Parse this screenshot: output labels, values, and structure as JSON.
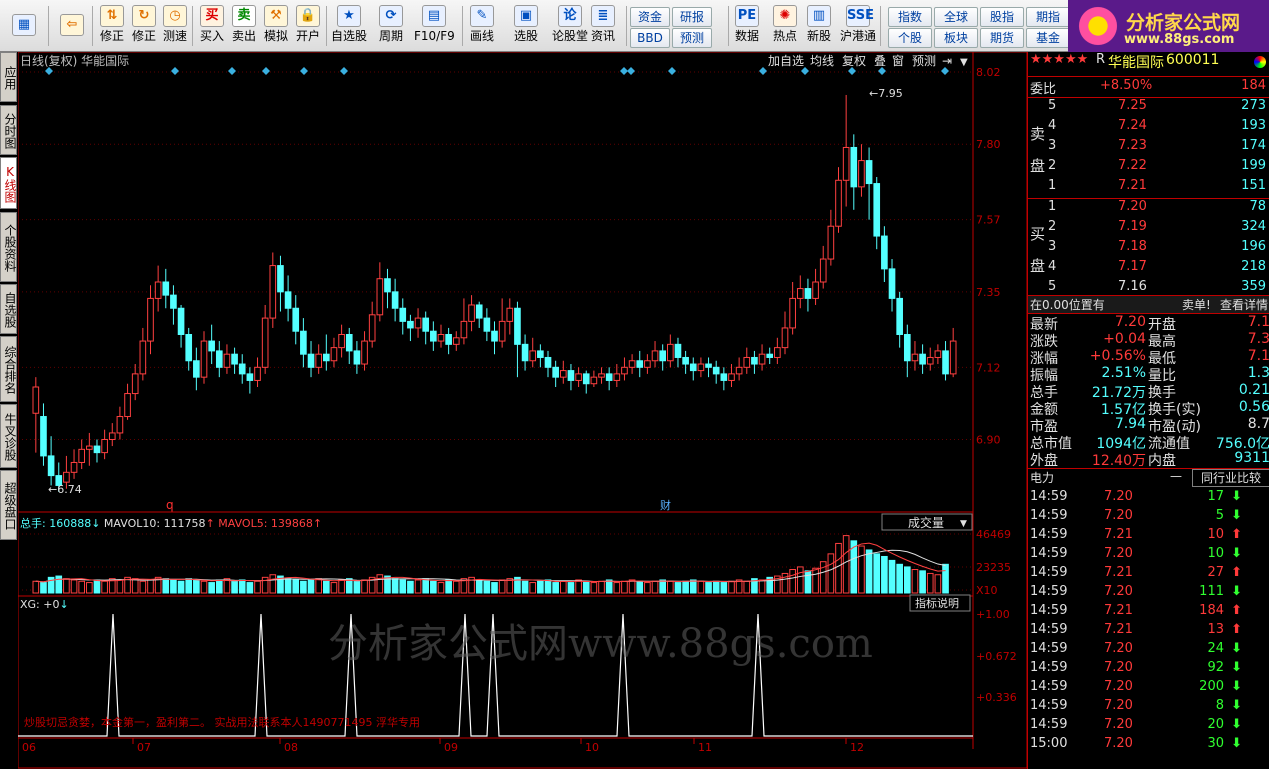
{
  "toolbar": {
    "items": [
      {
        "label": "",
        "icon": "windows-icon"
      },
      {
        "label": "",
        "icon": "back-arrow-icon"
      },
      {
        "label": "修正",
        "icon": "up-down-icon"
      },
      {
        "label": "修正",
        "icon": "refresh-icon"
      },
      {
        "label": "测速",
        "icon": "clock-icon"
      },
      {
        "label": "买入",
        "glyph": "买"
      },
      {
        "label": "卖出",
        "glyph": "卖"
      },
      {
        "label": "模拟",
        "icon": "hammer-icon"
      },
      {
        "label": "开户",
        "icon": "lock-icon"
      },
      {
        "label": "自选股",
        "icon": "star-icon"
      },
      {
        "label": "周期",
        "icon": "cycle-icon"
      },
      {
        "label": "F10/F9",
        "icon": "f10-icon"
      },
      {
        "label": "画线",
        "icon": "pen-icon"
      },
      {
        "label": "选股",
        "icon": "chart-icon"
      },
      {
        "label": "论股堂",
        "glyph": "论"
      },
      {
        "label": "资讯",
        "icon": "news-icon"
      },
      {
        "label": "数据",
        "glyph": "PE"
      },
      {
        "label": "热点",
        "icon": "fire-icon"
      },
      {
        "label": "新股",
        "icon": "ipo-icon"
      },
      {
        "label": "沪港通",
        "glyph": "SSE"
      }
    ],
    "small_buttons": [
      "资金",
      "BBD",
      "研报",
      "预测",
      "指数",
      "个股",
      "全球",
      "板块",
      "股指",
      "期货",
      "期指",
      "基金"
    ]
  },
  "logo": {
    "title": "分析家公式网",
    "url": "www.88gs.com"
  },
  "side_tabs": [
    "应用",
    "分时图",
    "K线图",
    "个股资料",
    "自选股",
    "综合排名",
    "牛叉诊股",
    "超级盘口"
  ],
  "chart_header": {
    "title": "日线(复权) 华能国际",
    "buttons": [
      "加自选",
      "均线",
      "复权",
      "叠",
      "窗",
      "预测"
    ]
  },
  "price_axis": [
    "8.02",
    "7.80",
    "7.57",
    "7.35",
    "7.12",
    "6.90"
  ],
  "annotations": {
    "high": "7.95",
    "low": "6.74",
    "q_marker": "q",
    "cai_marker": "财"
  },
  "volume_header": {
    "total_label": "总手:",
    "total": "160888",
    "arrow": "↓",
    "mavol10_label": "MAVOL10:",
    "mavol10": "111758",
    "mavol10_arrow": "↑",
    "mavol5_label": "MAVOL5:",
    "mavol5": "139868",
    "mavol5_arrow": "↑",
    "dropdown": "成交量"
  },
  "volume_axis": [
    "46469",
    "23235",
    "X10"
  ],
  "indicator": {
    "label": "XG: +0",
    "arrow": "↓",
    "button": "指标说明",
    "axis": [
      "+1.00",
      "+0.672",
      "+0.336"
    ]
  },
  "watermark": "分析家公式网www.88gs.com",
  "notice": "炒股切忌贪婪，本金第一，盈利第二。 实战用法联系本人1490771495  浮华专用",
  "x_axis": [
    "06",
    "07",
    "08",
    "09",
    "10",
    "11",
    "12"
  ],
  "quote": {
    "name": "华能国际",
    "code": "600011",
    "stars": "★★★★★",
    "flag": "R",
    "weibi_label": "委比",
    "weibi": "+8.50%",
    "weibi_vol": "184",
    "sell_label": [
      "卖",
      "盘"
    ],
    "sell": [
      {
        "n": "5",
        "p": "7.25",
        "v": "273"
      },
      {
        "n": "4",
        "p": "7.24",
        "v": "193"
      },
      {
        "n": "3",
        "p": "7.23",
        "v": "174"
      },
      {
        "n": "2",
        "p": "7.22",
        "v": "199"
      },
      {
        "n": "1",
        "p": "7.21",
        "v": "151"
      }
    ],
    "buy_label": [
      "买",
      "盘"
    ],
    "buy": [
      {
        "n": "1",
        "p": "7.20",
        "v": "78"
      },
      {
        "n": "2",
        "p": "7.19",
        "v": "324"
      },
      {
        "n": "3",
        "p": "7.18",
        "v": "196"
      },
      {
        "n": "4",
        "p": "7.17",
        "v": "218"
      },
      {
        "n": "5",
        "p": "7.16",
        "v": "359"
      }
    ],
    "pos_text": "在0.00位置有",
    "sell_note": "卖单!",
    "detail_link": "查看详情",
    "stats": [
      {
        "l": "最新",
        "v": "7.20",
        "l2": "开盘",
        "v2": "7.1"
      },
      {
        "l": "涨跌",
        "v": "+0.04",
        "l2": "最高",
        "v2": "7.3"
      },
      {
        "l": "涨幅",
        "v": "+0.56%",
        "l2": "最低",
        "v2": "7.1"
      },
      {
        "l": "振幅",
        "v": "2.51%",
        "l2": "量比",
        "v2": "1.3"
      },
      {
        "l": "总手",
        "v": "21.72万",
        "l2": "换手",
        "v2": "0.21"
      },
      {
        "l": "金额",
        "v": "1.57亿",
        "l2": "换手(实)",
        "v2": "0.56"
      },
      {
        "l": "市盈",
        "v": "7.94",
        "l2": "市盈(动)",
        "v2": "8.7"
      },
      {
        "l": "总市值",
        "v": "1094亿",
        "l2": "流通值",
        "v2": "756.0亿"
      },
      {
        "l": "外盘",
        "v": "12.40万",
        "l2": "内盘",
        "v2": "9311"
      }
    ],
    "industry_label": "电力",
    "industry_dash": "—",
    "compare_button": "同行业比较",
    "ticks": [
      {
        "t": "14:59",
        "p": "7.20",
        "v": "17",
        "d": "down"
      },
      {
        "t": "14:59",
        "p": "7.20",
        "v": "5",
        "d": "down"
      },
      {
        "t": "14:59",
        "p": "7.21",
        "v": "10",
        "d": "up"
      },
      {
        "t": "14:59",
        "p": "7.20",
        "v": "10",
        "d": "down"
      },
      {
        "t": "14:59",
        "p": "7.21",
        "v": "27",
        "d": "up"
      },
      {
        "t": "14:59",
        "p": "7.20",
        "v": "111",
        "d": "down"
      },
      {
        "t": "14:59",
        "p": "7.21",
        "v": "184",
        "d": "up"
      },
      {
        "t": "14:59",
        "p": "7.21",
        "v": "13",
        "d": "up"
      },
      {
        "t": "14:59",
        "p": "7.20",
        "v": "24",
        "d": "down"
      },
      {
        "t": "14:59",
        "p": "7.20",
        "v": "92",
        "d": "down"
      },
      {
        "t": "14:59",
        "p": "7.20",
        "v": "200",
        "d": "down"
      },
      {
        "t": "14:59",
        "p": "7.20",
        "v": "8",
        "d": "down"
      },
      {
        "t": "14:59",
        "p": "7.20",
        "v": "20",
        "d": "down"
      },
      {
        "t": "15:00",
        "p": "7.20",
        "v": "30",
        "d": "down"
      }
    ]
  },
  "chart_data": {
    "type": "candlestick",
    "ylim": [
      6.74,
      8.02
    ],
    "candles": [
      [
        6.98,
        7.06,
        6.86,
        7.09
      ],
      [
        6.97,
        6.85,
        6.82,
        7.01
      ],
      [
        6.85,
        6.79,
        6.76,
        6.91
      ],
      [
        6.79,
        6.76,
        6.74,
        6.83
      ],
      [
        6.77,
        6.8,
        6.75,
        6.85
      ],
      [
        6.8,
        6.83,
        6.78,
        6.87
      ],
      [
        6.83,
        6.87,
        6.81,
        6.9
      ],
      [
        6.87,
        6.88,
        6.82,
        6.92
      ],
      [
        6.88,
        6.86,
        6.83,
        6.9
      ],
      [
        6.86,
        6.9,
        6.84,
        6.93
      ],
      [
        6.9,
        6.92,
        6.88,
        6.95
      ],
      [
        6.92,
        6.97,
        6.9,
        7
      ],
      [
        6.97,
        7.04,
        6.96,
        7.07
      ],
      [
        7.04,
        7.1,
        7.02,
        7.13
      ],
      [
        7.1,
        7.2,
        7.08,
        7.24
      ],
      [
        7.2,
        7.33,
        7.16,
        7.37
      ],
      [
        7.33,
        7.38,
        7.29,
        7.43
      ],
      [
        7.38,
        7.34,
        7.3,
        7.42
      ],
      [
        7.34,
        7.3,
        7.25,
        7.37
      ],
      [
        7.3,
        7.22,
        7.18,
        7.31
      ],
      [
        7.22,
        7.14,
        7.11,
        7.24
      ],
      [
        7.14,
        7.09,
        7.05,
        7.18
      ],
      [
        7.09,
        7.2,
        7.07,
        7.23
      ],
      [
        7.2,
        7.17,
        7.13,
        7.25
      ],
      [
        7.17,
        7.12,
        7.09,
        7.2
      ],
      [
        7.12,
        7.16,
        7.1,
        7.19
      ],
      [
        7.16,
        7.13,
        7.1,
        7.18
      ],
      [
        7.13,
        7.1,
        7.07,
        7.16
      ],
      [
        7.1,
        7.08,
        7.04,
        7.12
      ],
      [
        7.08,
        7.12,
        7.06,
        7.15
      ],
      [
        7.12,
        7.27,
        7.1,
        7.31
      ],
      [
        7.27,
        7.43,
        7.24,
        7.47
      ],
      [
        7.43,
        7.35,
        7.29,
        7.46
      ],
      [
        7.35,
        7.3,
        7.26,
        7.4
      ],
      [
        7.3,
        7.23,
        7.19,
        7.34
      ],
      [
        7.23,
        7.16,
        7.12,
        7.27
      ],
      [
        7.16,
        7.12,
        7.09,
        7.2
      ],
      [
        7.12,
        7.16,
        7.1,
        7.19
      ],
      [
        7.16,
        7.14,
        7.11,
        7.22
      ],
      [
        7.14,
        7.18,
        7.12,
        7.21
      ],
      [
        7.18,
        7.22,
        7.15,
        7.25
      ],
      [
        7.22,
        7.17,
        7.13,
        7.24
      ],
      [
        7.17,
        7.13,
        7.1,
        7.2
      ],
      [
        7.13,
        7.2,
        7.11,
        7.23
      ],
      [
        7.2,
        7.28,
        7.18,
        7.32
      ],
      [
        7.28,
        7.39,
        7.26,
        7.44
      ],
      [
        7.39,
        7.35,
        7.3,
        7.42
      ],
      [
        7.35,
        7.3,
        7.26,
        7.39
      ],
      [
        7.3,
        7.26,
        7.22,
        7.33
      ],
      [
        7.26,
        7.24,
        7.2,
        7.28
      ],
      [
        7.24,
        7.27,
        7.21,
        7.3
      ],
      [
        7.27,
        7.23,
        7.19,
        7.29
      ],
      [
        7.23,
        7.2,
        7.17,
        7.26
      ],
      [
        7.2,
        7.22,
        7.18,
        7.25
      ],
      [
        7.22,
        7.19,
        7.16,
        7.24
      ],
      [
        7.19,
        7.21,
        7.17,
        7.23
      ],
      [
        7.21,
        7.26,
        7.19,
        7.33
      ],
      [
        7.26,
        7.31,
        7.23,
        7.34
      ],
      [
        7.31,
        7.27,
        7.24,
        7.32
      ],
      [
        7.27,
        7.23,
        7.2,
        7.3
      ],
      [
        7.23,
        7.2,
        7.16,
        7.26
      ],
      [
        7.2,
        7.26,
        7.18,
        7.33
      ],
      [
        7.26,
        7.3,
        7.22,
        7.33
      ],
      [
        7.3,
        7.19,
        7.09,
        7.32
      ],
      [
        7.19,
        7.14,
        7.11,
        7.22
      ],
      [
        7.14,
        7.17,
        7.12,
        7.21
      ],
      [
        7.17,
        7.15,
        7.12,
        7.19
      ],
      [
        7.15,
        7.12,
        7.09,
        7.17
      ],
      [
        7.12,
        7.09,
        7.06,
        7.14
      ],
      [
        7.09,
        7.11,
        7.07,
        7.14
      ],
      [
        7.11,
        7.08,
        7.05,
        7.13
      ],
      [
        7.08,
        7.1,
        7.06,
        7.12
      ],
      [
        7.1,
        7.07,
        7.04,
        7.11
      ],
      [
        7.07,
        7.09,
        7.06,
        7.11
      ],
      [
        7.09,
        7.1,
        7.07,
        7.12
      ],
      [
        7.1,
        7.08,
        7.05,
        7.12
      ],
      [
        7.08,
        7.1,
        7.06,
        7.13
      ],
      [
        7.1,
        7.12,
        7.08,
        7.15
      ],
      [
        7.12,
        7.14,
        7.1,
        7.16
      ],
      [
        7.14,
        7.12,
        7.09,
        7.17
      ],
      [
        7.12,
        7.14,
        7.1,
        7.16
      ],
      [
        7.14,
        7.17,
        7.12,
        7.2
      ],
      [
        7.17,
        7.14,
        7.11,
        7.19
      ],
      [
        7.14,
        7.19,
        7.12,
        7.22
      ],
      [
        7.19,
        7.15,
        7.12,
        7.21
      ],
      [
        7.15,
        7.13,
        7.1,
        7.17
      ],
      [
        7.13,
        7.11,
        7.08,
        7.15
      ],
      [
        7.11,
        7.13,
        7.09,
        7.15
      ],
      [
        7.13,
        7.12,
        7.09,
        7.15
      ],
      [
        7.12,
        7.1,
        7.07,
        7.14
      ],
      [
        7.1,
        7.08,
        7.05,
        7.12
      ],
      [
        7.08,
        7.1,
        7.06,
        7.13
      ],
      [
        7.1,
        7.12,
        7.08,
        7.15
      ],
      [
        7.12,
        7.15,
        7.1,
        7.18
      ],
      [
        7.15,
        7.13,
        7.1,
        7.17
      ],
      [
        7.13,
        7.16,
        7.11,
        7.19
      ],
      [
        7.16,
        7.15,
        7.13,
        7.18
      ],
      [
        7.15,
        7.18,
        7.13,
        7.21
      ],
      [
        7.18,
        7.24,
        7.16,
        7.29
      ],
      [
        7.24,
        7.33,
        7.22,
        7.38
      ],
      [
        7.33,
        7.36,
        7.3,
        7.4
      ],
      [
        7.36,
        7.33,
        7.29,
        7.39
      ],
      [
        7.33,
        7.38,
        7.31,
        7.42
      ],
      [
        7.38,
        7.45,
        7.36,
        7.49
      ],
      [
        7.45,
        7.55,
        7.43,
        7.6
      ],
      [
        7.55,
        7.69,
        7.53,
        7.73
      ],
      [
        7.69,
        7.79,
        7.61,
        7.95
      ],
      [
        7.79,
        7.67,
        7.6,
        7.83
      ],
      [
        7.67,
        7.75,
        7.64,
        7.8
      ],
      [
        7.75,
        7.68,
        7.57,
        7.79
      ],
      [
        7.68,
        7.52,
        7.48,
        7.7
      ],
      [
        7.52,
        7.42,
        7.38,
        7.55
      ],
      [
        7.42,
        7.33,
        7.29,
        7.45
      ],
      [
        7.33,
        7.22,
        7.18,
        7.35
      ],
      [
        7.22,
        7.14,
        7.09,
        7.25
      ],
      [
        7.14,
        7.16,
        7.11,
        7.2
      ],
      [
        7.16,
        7.13,
        7.1,
        7.19
      ],
      [
        7.13,
        7.15,
        7.11,
        7.18
      ],
      [
        7.15,
        7.17,
        7.13,
        7.19
      ],
      [
        7.17,
        7.1,
        7.08,
        7.2
      ],
      [
        7.1,
        7.2,
        7.09,
        7.24
      ]
    ],
    "volume": [
      9,
      8,
      12,
      13,
      11,
      10,
      9,
      8,
      10,
      9,
      11,
      10,
      12,
      11,
      9,
      10,
      12,
      11,
      10,
      9,
      11,
      10,
      9,
      8,
      10,
      11,
      9,
      10,
      8,
      9,
      12,
      14,
      13,
      11,
      10,
      9,
      10,
      11,
      9,
      8,
      10,
      11,
      9,
      10,
      12,
      14,
      13,
      11,
      10,
      9,
      10,
      11,
      9,
      8,
      10,
      9,
      11,
      12,
      10,
      9,
      8,
      10,
      11,
      12,
      9,
      8,
      9,
      10,
      8,
      9,
      8,
      10,
      9,
      8,
      9,
      10,
      8,
      9,
      10,
      9,
      8,
      9,
      10,
      9,
      8,
      9,
      10,
      9,
      8,
      9,
      8,
      9,
      10,
      9,
      11,
      10,
      12,
      13,
      15,
      18,
      20,
      17,
      19,
      24,
      30,
      38,
      44,
      40,
      36,
      33,
      30,
      28,
      25,
      22,
      20,
      18,
      17,
      15,
      14,
      22
    ],
    "xg_signals_x": [
      113,
      261,
      351,
      465,
      493,
      623,
      758
    ],
    "blue_dot_x": [
      45,
      171,
      228,
      262,
      300,
      340,
      620,
      627,
      668,
      759,
      801,
      848,
      878,
      941
    ]
  }
}
